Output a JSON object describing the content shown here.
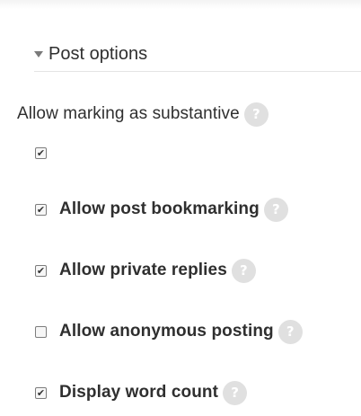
{
  "section": {
    "title": "Post options"
  },
  "substantive": {
    "label": "Allow marking as substantive",
    "help": "?",
    "checked": true
  },
  "options": [
    {
      "label": "Allow post bookmarking",
      "checked": true,
      "help": "?"
    },
    {
      "label": "Allow private replies",
      "checked": true,
      "help": "?"
    },
    {
      "label": "Allow anonymous posting",
      "checked": false,
      "help": "?"
    },
    {
      "label": "Display word count",
      "checked": true,
      "help": "?"
    }
  ],
  "icons": {
    "collapse": "caret-down-icon",
    "help": "question-circle-icon",
    "check": "checkmark-icon"
  },
  "colors": {
    "text": "#2f2f2f",
    "help_bg": "#e0e0e0",
    "divider": "#e4e4e4"
  }
}
